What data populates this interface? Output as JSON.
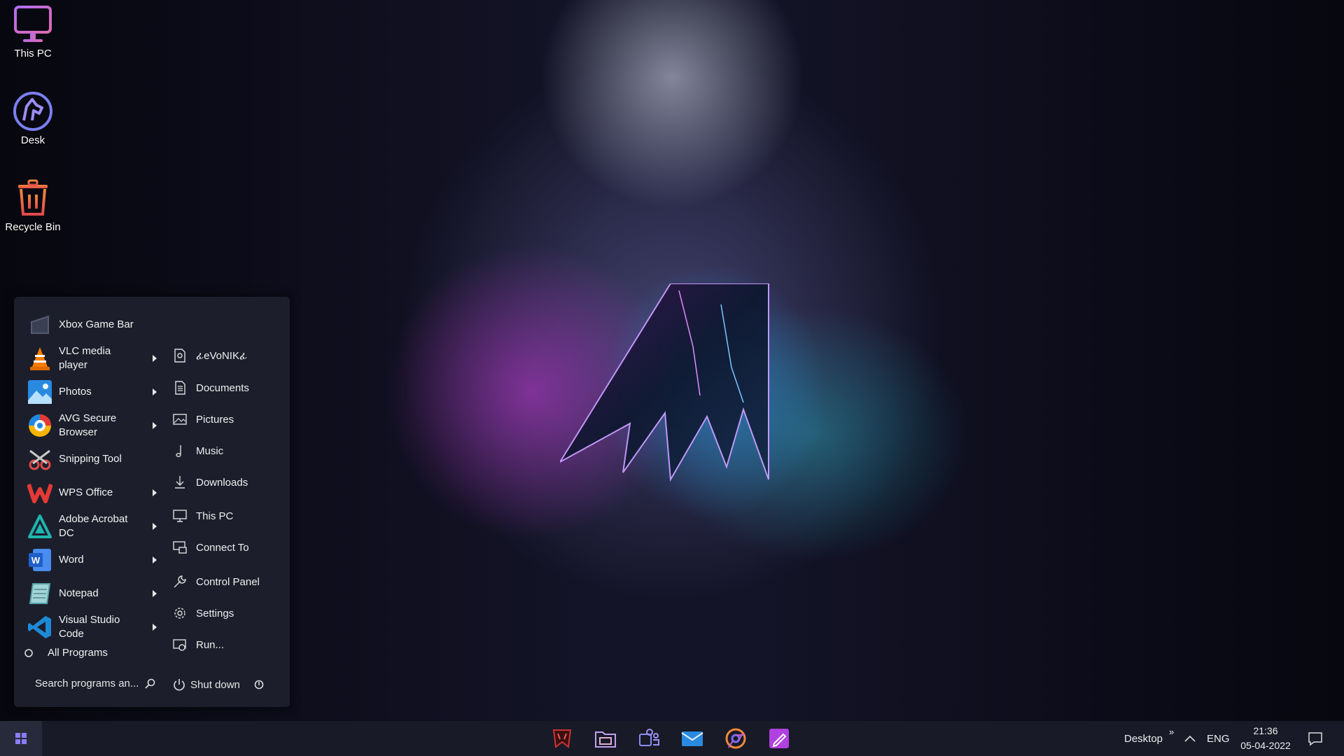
{
  "desktop": {
    "icons": [
      {
        "label": "This PC",
        "icon": "monitor-icon"
      },
      {
        "label": "Desk",
        "icon": "horse-logo-icon"
      },
      {
        "label": "Recycle Bin",
        "icon": "trash-icon"
      }
    ]
  },
  "start_menu": {
    "programs": [
      {
        "label": "Xbox Game Bar",
        "icon": "xbox-game-bar-icon",
        "has_submenu": false
      },
      {
        "label": "VLC media player",
        "icon": "vlc-cone-icon",
        "has_submenu": true
      },
      {
        "label": "Photos",
        "icon": "photos-icon",
        "has_submenu": true
      },
      {
        "label": "AVG Secure Browser",
        "icon": "avg-browser-icon",
        "has_submenu": true
      },
      {
        "label": "Snipping Tool",
        "icon": "snipping-tool-icon",
        "has_submenu": false
      },
      {
        "label": "WPS Office",
        "icon": "wps-office-icon",
        "has_submenu": true
      },
      {
        "label": "Adobe Acrobat DC",
        "icon": "acrobat-icon",
        "has_submenu": true
      },
      {
        "label": "Word",
        "icon": "word-icon",
        "has_submenu": true
      },
      {
        "label": "Notepad",
        "icon": "notepad-icon",
        "has_submenu": true
      },
      {
        "label": "Visual Studio Code",
        "icon": "vscode-icon",
        "has_submenu": true
      }
    ],
    "all_programs": "All Programs",
    "places": [
      {
        "label": "ፊeVoNIKፊ",
        "icon": "user-folder-icon"
      },
      {
        "label": "Documents",
        "icon": "document-icon"
      },
      {
        "label": "Pictures",
        "icon": "picture-icon"
      },
      {
        "label": "Music",
        "icon": "music-note-icon"
      },
      {
        "label": "Downloads",
        "icon": "download-icon"
      },
      {
        "label": "This PC",
        "icon": "computer-icon"
      },
      {
        "label": "Connect To",
        "icon": "connect-icon"
      },
      {
        "label": "Control Panel",
        "icon": "wrench-icon"
      },
      {
        "label": "Settings",
        "icon": "gear-icon"
      },
      {
        "label": "Run...",
        "icon": "run-icon"
      }
    ],
    "search_placeholder": "Search programs an...",
    "shutdown_label": "Shut down"
  },
  "taskbar": {
    "pinned": [
      "predator-icon",
      "file-explorer-icon",
      "teams-icon",
      "mail-icon",
      "chrome-icon",
      "edit-app-icon"
    ],
    "desktop_label": "Desktop",
    "language": "ENG",
    "time": "21:36",
    "date": "05-04-2022"
  },
  "colors": {
    "start_menu_bg": "#1c1f2b",
    "taskbar_bg": "#181a27"
  }
}
